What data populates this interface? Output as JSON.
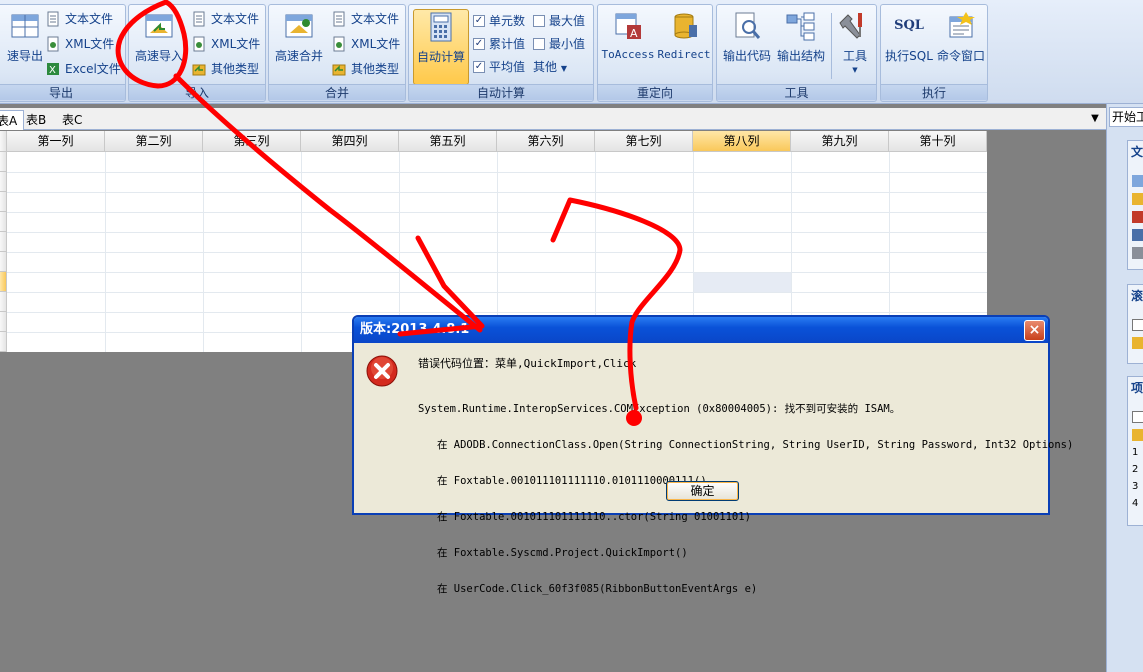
{
  "ribbon": {
    "export": {
      "label": "导出",
      "big": "速导出",
      "text_file": "文本文件",
      "xml_file": "XML文件",
      "excel_file": "Excel文件"
    },
    "import": {
      "label": "导入",
      "big": "高速导入",
      "text_file": "文本文件",
      "xml_file": "XML文件",
      "other": "其他类型"
    },
    "merge": {
      "label": "合并",
      "big": "高速合并",
      "text_file": "文本文件",
      "xml_file": "XML文件",
      "other": "其他类型"
    },
    "autocalc": {
      "label": "自动计算",
      "big": "自动计算",
      "unit_count": "单元数",
      "cumulative": "累计值",
      "average": "平均值",
      "max": "最大值",
      "min": "最小值",
      "other": "其他"
    },
    "redirect": {
      "label": "重定向",
      "to_access": "ToAccess",
      "redirect": "Redirect"
    },
    "tools": {
      "label": "工具",
      "output_code": "输出代码",
      "output_structure": "输出结构",
      "tools": "工具"
    },
    "execute": {
      "label": "执行",
      "exec_sql": "执行SQL",
      "cmd_window": "命令窗口",
      "sql_icon_text": "SQL"
    }
  },
  "tabs": [
    "表A",
    "表B",
    "表C"
  ],
  "right_top": "开始工",
  "right_panel": {
    "box1_title": "文",
    "box2_title": "滚",
    "box3_title": "项",
    "box3_items": [
      "1",
      "2",
      "3",
      "4"
    ]
  },
  "grid": {
    "columns": [
      "第一列",
      "第二列",
      "第三列",
      "第四列",
      "第五列",
      "第六列",
      "第七列",
      "第八列",
      "第九列",
      "第十列"
    ]
  },
  "dialog": {
    "title": "版本:2013.4.8.1",
    "close": "×",
    "error_location": "错误代码位置：菜单,QuickImport,Click",
    "error_lines": [
      "System.Runtime.InteropServices.COMException (0x80004005): 找不到可安装的 ISAM。",
      "   在 ADODB.ConnectionClass.Open(String ConnectionString, String UserID, String Password, Int32 Options)",
      "   在 Foxtable.001011101111110.0101110000111()",
      "   在 Foxtable.001011101111110..ctor(String 01001101)",
      "   在 Foxtable.Syscmd.Project.QuickImport()",
      "   在 UserCode.Click_60f3f085(RibbonButtonEventArgs e)"
    ],
    "ok": "确定"
  }
}
